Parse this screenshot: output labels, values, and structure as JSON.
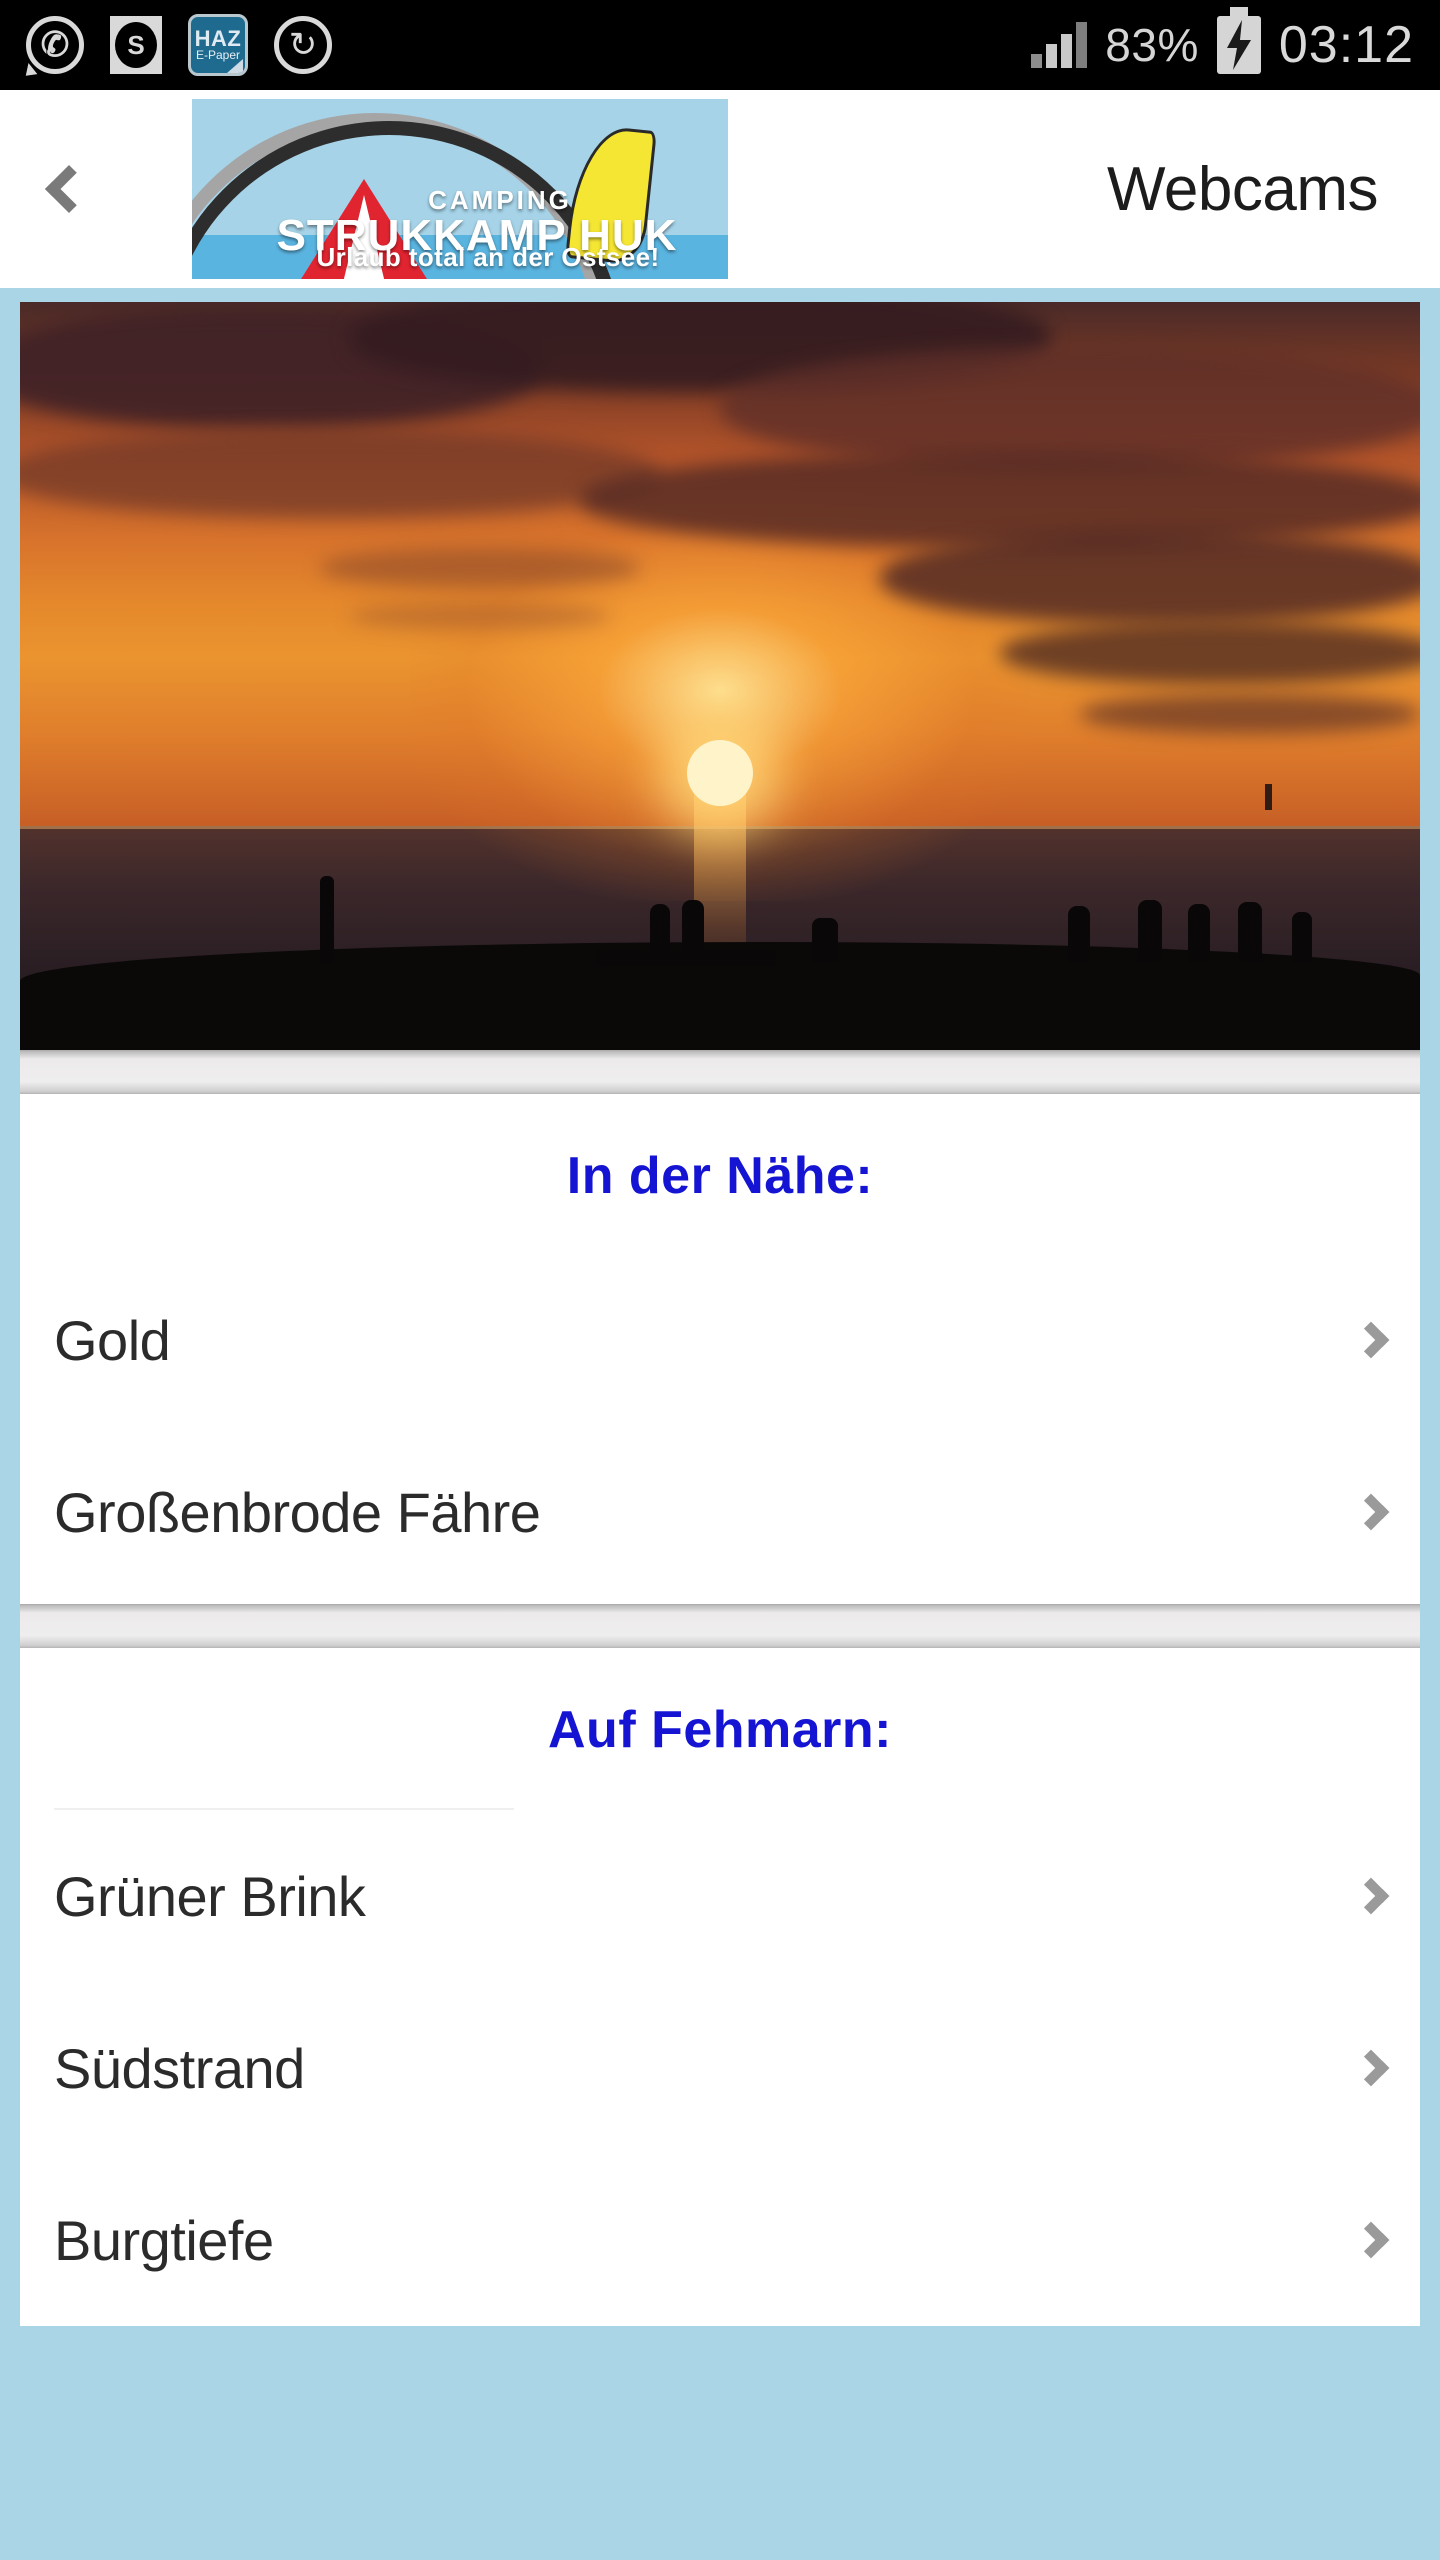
{
  "statusbar": {
    "notifications": [
      {
        "name": "whatsapp-icon",
        "glyph": "✆"
      },
      {
        "name": "s-badge-icon",
        "glyph": "S"
      },
      {
        "name": "haz-epaper-icon",
        "line1": "HAZ",
        "line2": "E-Paper"
      },
      {
        "name": "sync-icon",
        "glyph": "↻"
      }
    ],
    "signal_label": "signal-bars",
    "battery_percent": "83%",
    "battery_state": "charging",
    "clock": "03:12"
  },
  "appbar": {
    "back_label": "chevron-left",
    "title": "Webcams",
    "logo": {
      "line1": "CAMPING",
      "line2": "STRUKKAMP HUK",
      "line3": "Urlaub total an der Ostsee!"
    }
  },
  "hero": {
    "alt": "Sunset over the Baltic Sea with silhouetted people on the shore"
  },
  "sections": [
    {
      "title": "In der Nähe:",
      "items": [
        {
          "label": "Gold"
        },
        {
          "label": "Großenbrode Fähre"
        }
      ]
    },
    {
      "title": "Auf Fehmarn:",
      "items": [
        {
          "label": "Grüner Brink"
        },
        {
          "label": "Südstrand"
        },
        {
          "label": "Burgtiefe"
        }
      ]
    }
  ],
  "colors": {
    "page_background": "#a9d5e6",
    "section_heading": "#1414d2",
    "card_background": "#ffffff",
    "row_text": "#2b2b2b",
    "chevron": "#9a9a9a",
    "statusbar_background": "#000000"
  }
}
